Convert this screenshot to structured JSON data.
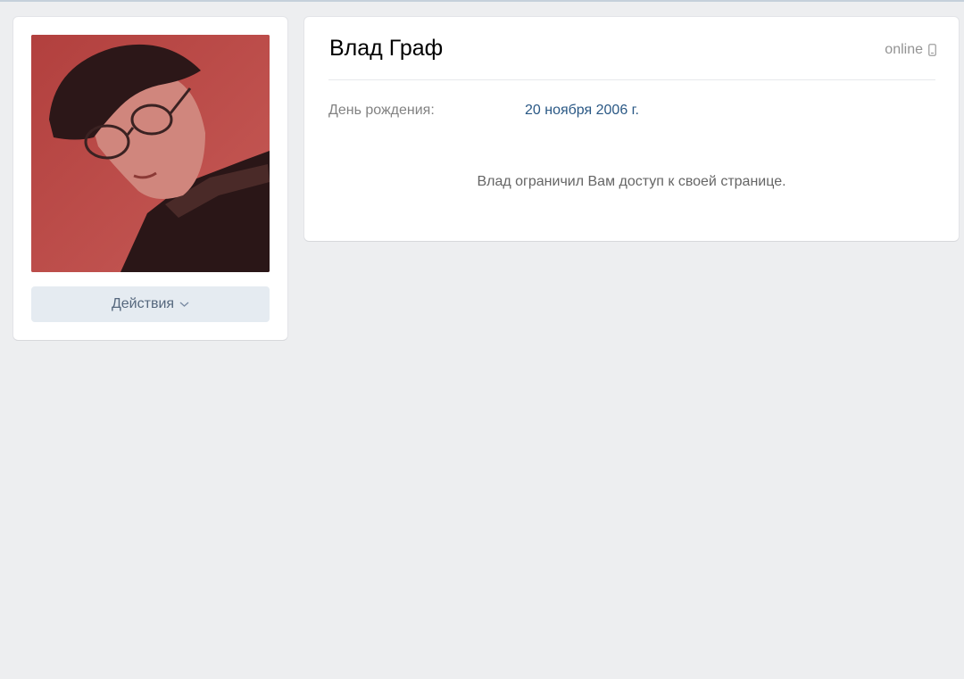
{
  "profile": {
    "name": "Влад Граф",
    "status": "online",
    "status_icon": "mobile-phone-icon"
  },
  "info": {
    "birthday_label": "День рождения:",
    "birthday_value": "20 ноября 2006 г."
  },
  "notice": {
    "text": "Влад ограничил Вам доступ к своей странице."
  },
  "actions": {
    "label": "Действия",
    "icon": "chevron-down-icon"
  },
  "colors": {
    "page_bg": "#edeef0",
    "card_bg": "#ffffff",
    "button_bg": "#e5ebf1",
    "link": "#2a5885",
    "avatar_tint": "#b54a45"
  }
}
